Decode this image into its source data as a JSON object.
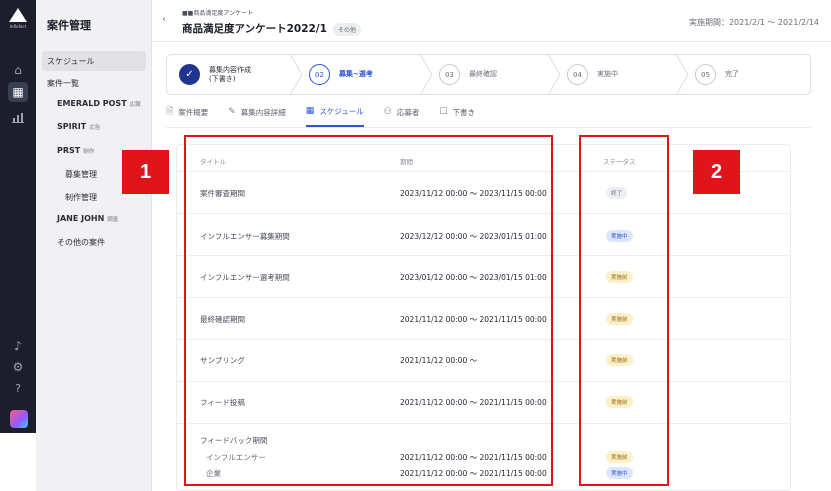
{
  "rail": {
    "logo_text": "Influfect",
    "icons": [
      "home-icon",
      "calendar-icon",
      "chart-icon",
      "bell-icon",
      "gear-icon",
      "help-icon"
    ]
  },
  "sidebar": {
    "title": "案件管理",
    "schedule": "スケジュール",
    "case_list": "案件一覧",
    "emerald": {
      "label": "EMERALD POST",
      "tag": "広報"
    },
    "spirit": {
      "label": "SPIRIT",
      "tag": "広告"
    },
    "prst": {
      "label": "PRST",
      "tag": "制作"
    },
    "recruit": "募集管理",
    "production": "制作管理",
    "jane": {
      "label": "JANE JOHN",
      "tag": "調査"
    },
    "others": "その他の案件"
  },
  "header": {
    "back": "‹",
    "subtitle": "■■商品満足度アンケート",
    "title": "商品満足度アンケート2022/1",
    "badge": "その他",
    "period": "実施期間：2021/2/1 〜 2021/2/14"
  },
  "stepper": {
    "steps": [
      {
        "num": "✓",
        "label1": "募集内容作成",
        "label2": "(下書き)"
      },
      {
        "num": "02",
        "label1": "募集~選考",
        "label2": ""
      },
      {
        "num": "03",
        "label1": "最終確認",
        "label2": ""
      },
      {
        "num": "04",
        "label1": "実施中",
        "label2": ""
      },
      {
        "num": "05",
        "label1": "完了",
        "label2": ""
      }
    ]
  },
  "tabs": [
    {
      "icon": "document-icon",
      "glyph": "🗎",
      "label": "案件概要"
    },
    {
      "icon": "pencil-icon",
      "glyph": "✎",
      "label": "募集内容詳細"
    },
    {
      "icon": "calendar-icon",
      "glyph": "▦",
      "label": "スケジュール"
    },
    {
      "icon": "people-icon",
      "glyph": "⚇",
      "label": "応募者"
    },
    {
      "icon": "draft-icon",
      "glyph": "☐",
      "label": "下書き"
    }
  ],
  "table": {
    "headers": {
      "title": "タイトル",
      "period": "期間",
      "status": "ステータス"
    },
    "rows": [
      {
        "title": "案件審査期間",
        "period": "2023/11/12 00:00 〜 2023/11/15 00:00",
        "status": "終了"
      },
      {
        "title": "インフルエンサー募集期間",
        "period": "2023/12/12 00:00 〜 2023/01/15 01:00",
        "status": "実施中"
      },
      {
        "title": "インフルエンサー選考期間",
        "period": "2023/01/12 00:00 〜 2023/01/15 01:00",
        "status": "実施前"
      },
      {
        "title": "最終確認期間",
        "period": "2021/11/12 00:00 〜 2021/11/15 00:00",
        "status": "実施前"
      },
      {
        "title": "サンプリング",
        "period": "2021/11/12 00:00 〜",
        "status": "実施前"
      },
      {
        "title": "フィード投稿",
        "period": "2021/11/12 00:00 〜 2021/11/15 00:00",
        "status": "実施前"
      }
    ],
    "feedback": {
      "title": "フィードバック期間",
      "sub1": "インフルエンサー",
      "sub2": "企業",
      "period1": "2021/11/12 00:00 〜 2021/11/15 00:00",
      "period2": "2021/11/12 00:00 〜 2021/11/15 00:00",
      "status1": "実施前",
      "status2": "実施中"
    }
  },
  "annotations": {
    "box1": "1",
    "box2": "2"
  },
  "colors": {
    "accent": "#2f55d4",
    "annotation": "#e0151c",
    "rail": "#1c1f2b"
  }
}
